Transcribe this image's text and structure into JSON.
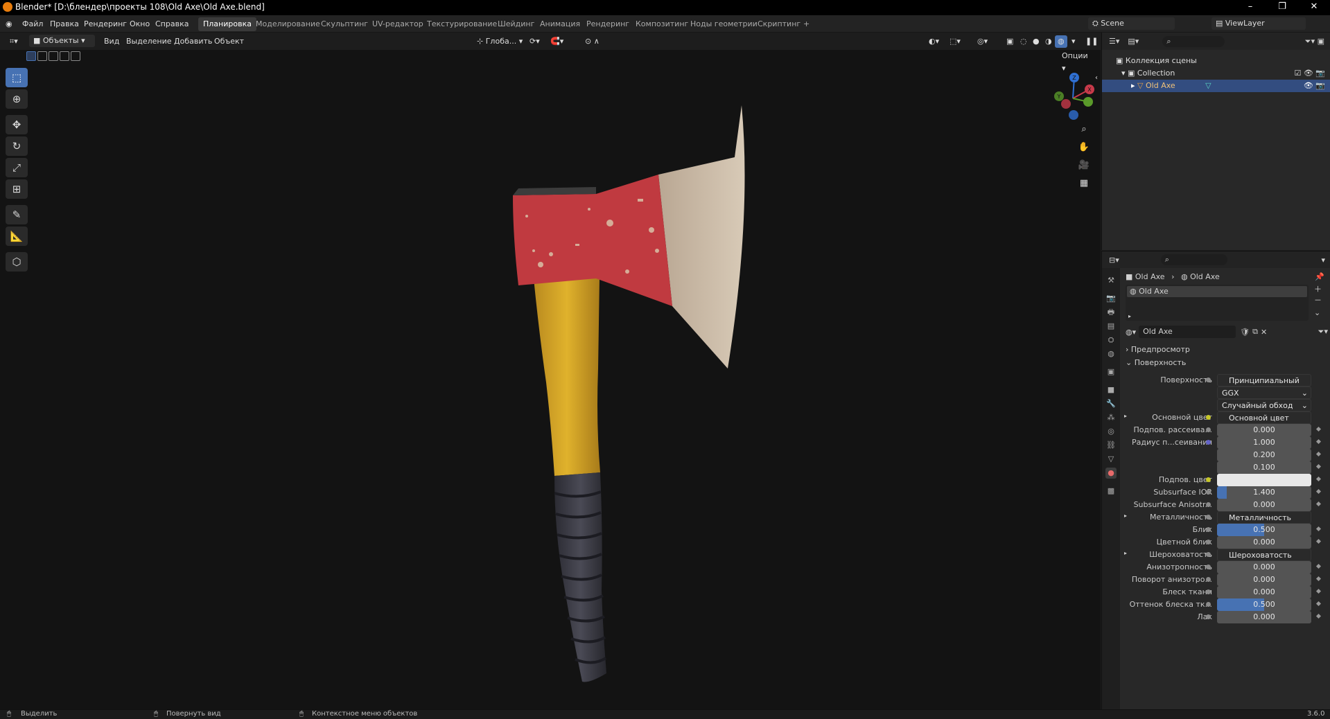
{
  "window": {
    "title": "Blender* [D:\\блендер\\проекты 108\\Old Axe\\Old Axe.blend]"
  },
  "menu": [
    "Файл",
    "Правка",
    "Рендеринг",
    "Окно",
    "Справка"
  ],
  "workspaces": [
    "Планировка",
    "Моделирование",
    "Скульптинг",
    "UV-редактор",
    "Текстурирование",
    "Шейдинг",
    "Анимация",
    "Рендеринг",
    "Композитинг",
    "Ноды геометрии",
    "Скриптинг"
  ],
  "workspace_add": "+",
  "scene": {
    "name": "Scene",
    "view_layer": "ViewLayer"
  },
  "viewport_header": {
    "mode": "Объекты",
    "view": "Вид",
    "select": "Выделение",
    "add": "Добавить",
    "object": "Объект",
    "transform_orientation": "Глоба...",
    "options": "Опции"
  },
  "gizmo": {
    "x": "X",
    "y": "Y",
    "z": "Z"
  },
  "outliner": {
    "root": "Коллекция сцены",
    "collection": "Collection",
    "object": "Old Axe"
  },
  "properties": {
    "breadcrumb": [
      "Old Axe",
      "Old Axe"
    ],
    "material_slot": "Old Axe",
    "material_name": "Old Axe",
    "sections": {
      "preview": "Предпросмотр",
      "surface": "Поверхность"
    },
    "rows": [
      {
        "label": "Поверхность",
        "value": "Принципиальный BSDF",
        "type": "link",
        "dot": "g"
      },
      {
        "label": "",
        "value": "GGX",
        "type": "dropdown"
      },
      {
        "label": "",
        "value": "Случайный обход",
        "type": "dropdown"
      },
      {
        "label": "Основной цвет",
        "value": "Основной цвет",
        "type": "link",
        "dot": "y",
        "expand": true
      },
      {
        "label": "Подпов. рассеива...",
        "value": "0.000",
        "type": "num",
        "dot": "g"
      },
      {
        "label": "Радиус п...сеивания",
        "value": "1.000",
        "type": "num",
        "dot": "b"
      },
      {
        "label": "",
        "value": "0.200",
        "type": "num"
      },
      {
        "label": "",
        "value": "0.100",
        "type": "num"
      },
      {
        "label": "Подпов. цвет",
        "value": "",
        "type": "color",
        "dot": "y"
      },
      {
        "label": "Subsurface IOR",
        "value": "1.400",
        "type": "num",
        "dot": "g",
        "fill": 0.1
      },
      {
        "label": "Subsurface Anisotr...",
        "value": "0.000",
        "type": "num",
        "dot": "g"
      },
      {
        "label": "Металличность",
        "value": "Металличность",
        "type": "link",
        "dot": "g",
        "expand": true
      },
      {
        "label": "Блик",
        "value": "0.500",
        "type": "num",
        "dot": "g",
        "fill": 0.5
      },
      {
        "label": "Цветной блик",
        "value": "0.000",
        "type": "num",
        "dot": "g"
      },
      {
        "label": "Шероховатость",
        "value": "Шероховатость",
        "type": "link",
        "dot": "g",
        "expand": true
      },
      {
        "label": "Анизотропность",
        "value": "0.000",
        "type": "num",
        "dot": "g"
      },
      {
        "label": "Поворот анизотро...",
        "value": "0.000",
        "type": "num",
        "dot": "g"
      },
      {
        "label": "Блеск ткани",
        "value": "0.000",
        "type": "num",
        "dot": "g"
      },
      {
        "label": "Оттенок блеска тк...",
        "value": "0.500",
        "type": "num",
        "dot": "g",
        "fill": 0.5
      },
      {
        "label": "Лак",
        "value": "0.000",
        "type": "num",
        "dot": "g"
      }
    ]
  },
  "status": {
    "select": "Выделить",
    "rotate": "Повернуть вид",
    "context": "Контекстное меню объектов",
    "version": "3.6.0"
  },
  "colors": {
    "accent": "#4772b3",
    "axe_red": "#c03a40",
    "handle_yellow": "#d9a626",
    "grip_dark": "#3a3a42"
  }
}
